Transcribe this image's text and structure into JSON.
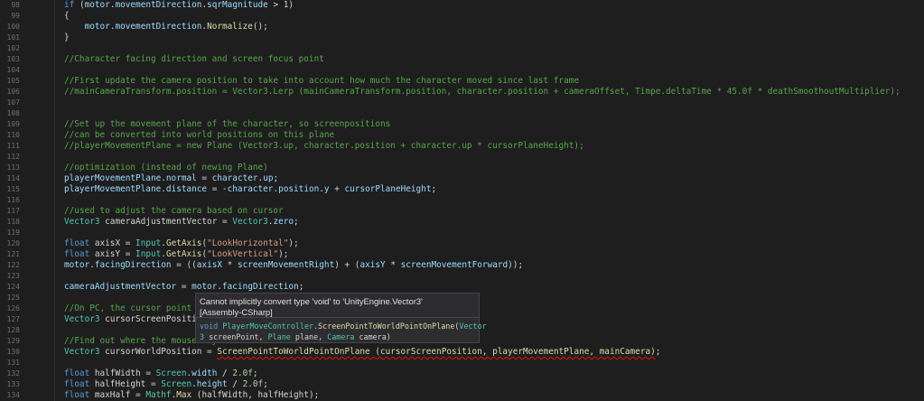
{
  "colors": {
    "background": "#1e1e1e",
    "comment": "#57a64a",
    "keyword": "#569cd6",
    "string": "#d69d85",
    "type": "#4ec9b0",
    "method": "#dcdcaa",
    "field": "#9cdcfe",
    "error_squiggle": "#e51400"
  },
  "lines": [
    {
      "num": "98",
      "tokens": [
        [
          "k",
          "if"
        ],
        [
          "p",
          " ("
        ],
        [
          "f",
          "motor"
        ],
        [
          "p",
          "."
        ],
        [
          "f",
          "movementDirection"
        ],
        [
          "p",
          "."
        ],
        [
          "f",
          "sqrMagnitude"
        ],
        [
          "p",
          " > 1)"
        ]
      ]
    },
    {
      "num": "99",
      "tokens": [
        [
          "p",
          "{"
        ]
      ]
    },
    {
      "num": "100",
      "tokens": [
        [
          "p",
          "    "
        ],
        [
          "f",
          "motor"
        ],
        [
          "p",
          "."
        ],
        [
          "f",
          "movementDirection"
        ],
        [
          "p",
          "."
        ],
        [
          "m",
          "Normalize"
        ],
        [
          "p",
          "();"
        ]
      ]
    },
    {
      "num": "101",
      "tokens": [
        [
          "p",
          "}"
        ]
      ]
    },
    {
      "num": "102",
      "tokens": []
    },
    {
      "num": "103",
      "tokens": [
        [
          "c",
          "//Character facing direction and screen focus point"
        ]
      ]
    },
    {
      "num": "104",
      "tokens": []
    },
    {
      "num": "105",
      "tokens": [
        [
          "c",
          "//First update the camera position to take into account how much the character moved since last frame"
        ]
      ]
    },
    {
      "num": "106",
      "tokens": [
        [
          "c",
          "//mainCameraTransform.position = Vector3.Lerp (mainCameraTransform.position, character.position + cameraOffset, Timpe.deltaTime * 45.0f * deathSmoothoutMultiplier);"
        ]
      ]
    },
    {
      "num": "107",
      "tokens": []
    },
    {
      "num": "108",
      "tokens": []
    },
    {
      "num": "109",
      "tokens": [
        [
          "c",
          "//Set up the movement plane of the character, so screenpositions"
        ]
      ]
    },
    {
      "num": "110",
      "tokens": [
        [
          "c",
          "//can be converted into world positions on this plane"
        ]
      ]
    },
    {
      "num": "111",
      "tokens": [
        [
          "c",
          "//playerMovementPlane = new Plane (Vector3.up, character.position + character.up * cursorPlaneHeight);"
        ]
      ]
    },
    {
      "num": "112",
      "tokens": []
    },
    {
      "num": "113",
      "tokens": [
        [
          "c",
          "//optimization (instead of newing Plane)"
        ]
      ]
    },
    {
      "num": "114",
      "tokens": [
        [
          "f",
          "playerMovementPlane"
        ],
        [
          "p",
          "."
        ],
        [
          "f",
          "normal"
        ],
        [
          "p",
          " = "
        ],
        [
          "f",
          "character"
        ],
        [
          "p",
          "."
        ],
        [
          "f",
          "up"
        ],
        [
          "p",
          ";"
        ]
      ]
    },
    {
      "num": "115",
      "tokens": [
        [
          "f",
          "playerMovementPlane"
        ],
        [
          "p",
          "."
        ],
        [
          "f",
          "distance"
        ],
        [
          "p",
          " = -"
        ],
        [
          "f",
          "character"
        ],
        [
          "p",
          "."
        ],
        [
          "f",
          "position"
        ],
        [
          "p",
          "."
        ],
        [
          "f",
          "y"
        ],
        [
          "p",
          " + "
        ],
        [
          "f",
          "cursorPlaneHeight"
        ],
        [
          "p",
          ";"
        ]
      ]
    },
    {
      "num": "116",
      "tokens": []
    },
    {
      "num": "117",
      "tokens": [
        [
          "c",
          "//used to adjust the camera based on cursor"
        ]
      ]
    },
    {
      "num": "118",
      "tokens": [
        [
          "t",
          "Vector3"
        ],
        [
          "p",
          " cameraAdjustmentVector = "
        ],
        [
          "t",
          "Vector3"
        ],
        [
          "p",
          "."
        ],
        [
          "f",
          "zero"
        ],
        [
          "p",
          ";"
        ]
      ]
    },
    {
      "num": "119",
      "tokens": []
    },
    {
      "num": "120",
      "tokens": [
        [
          "k",
          "float"
        ],
        [
          "p",
          " axisX = "
        ],
        [
          "t",
          "Input"
        ],
        [
          "p",
          "."
        ],
        [
          "m",
          "GetAxis"
        ],
        [
          "p",
          "("
        ],
        [
          "s",
          "\"LookHorizontal\""
        ],
        [
          "p",
          ");"
        ]
      ]
    },
    {
      "num": "121",
      "tokens": [
        [
          "k",
          "float"
        ],
        [
          "p",
          " axisY = "
        ],
        [
          "t",
          "Input"
        ],
        [
          "p",
          "."
        ],
        [
          "m",
          "GetAxis"
        ],
        [
          "p",
          "("
        ],
        [
          "s",
          "\"LookVertical\""
        ],
        [
          "p",
          ");"
        ]
      ]
    },
    {
      "num": "122",
      "tokens": [
        [
          "f",
          "motor"
        ],
        [
          "p",
          "."
        ],
        [
          "f",
          "facingDirection"
        ],
        [
          "p",
          " = (("
        ],
        [
          "f",
          "axisX"
        ],
        [
          "p",
          " * "
        ],
        [
          "f",
          "screenMovementRight"
        ],
        [
          "p",
          ") + ("
        ],
        [
          "f",
          "axisY"
        ],
        [
          "p",
          " * "
        ],
        [
          "f",
          "screenMovementForward"
        ],
        [
          "p",
          "));"
        ]
      ]
    },
    {
      "num": "123",
      "tokens": []
    },
    {
      "num": "124",
      "tokens": [
        [
          "f",
          "cameraAdjustmentVector"
        ],
        [
          "p",
          " = "
        ],
        [
          "f",
          "motor"
        ],
        [
          "p",
          "."
        ],
        [
          "f",
          "facingDirection"
        ],
        [
          "p",
          ";"
        ]
      ]
    },
    {
      "num": "125",
      "tokens": []
    },
    {
      "num": "126",
      "tokens": [
        [
          "c",
          "//On PC, the cursor point is t"
        ]
      ]
    },
    {
      "num": "127",
      "tokens": [
        [
          "t",
          "Vector3"
        ],
        [
          "p",
          " cursorScreenPosition = "
        ]
      ]
    },
    {
      "num": "128",
      "tokens": []
    },
    {
      "num": "129",
      "tokens": [
        [
          "c",
          "//Find out where the mouse ray"
        ]
      ]
    },
    {
      "num": "130",
      "tokens": [
        [
          "t",
          "Vector3"
        ],
        [
          "p",
          " cursorWorldPosition = "
        ],
        [
          "e",
          "ScreenPointToWorldPointOnPlane (cursorScreenPosition, playerMovementPlane, mainCamera)"
        ],
        [
          "p",
          ";"
        ]
      ]
    },
    {
      "num": "131",
      "tokens": []
    },
    {
      "num": "132",
      "tokens": [
        [
          "k",
          "float"
        ],
        [
          "p",
          " halfWidth = "
        ],
        [
          "t",
          "Screen"
        ],
        [
          "p",
          "."
        ],
        [
          "f",
          "width"
        ],
        [
          "p",
          " / "
        ],
        [
          "n",
          "2.0f"
        ],
        [
          "p",
          ";"
        ]
      ]
    },
    {
      "num": "133",
      "tokens": [
        [
          "k",
          "float"
        ],
        [
          "p",
          " halfHeight = "
        ],
        [
          "t",
          "Screen"
        ],
        [
          "p",
          "."
        ],
        [
          "f",
          "height"
        ],
        [
          "p",
          " / "
        ],
        [
          "n",
          "2.0f"
        ],
        [
          "p",
          ";"
        ]
      ]
    },
    {
      "num": "134",
      "tokens": [
        [
          "k",
          "float"
        ],
        [
          "p",
          " maxHalf = "
        ],
        [
          "t",
          "Mathf"
        ],
        [
          "p",
          "."
        ],
        [
          "m",
          "Max"
        ],
        [
          "p",
          " (halfWidth, halfHeight);"
        ]
      ]
    }
  ],
  "tooltip": {
    "error_message": "Cannot implicitly convert type 'void' to 'UnityEngine.Vector3'",
    "assembly": "[Assembly-CSharp]",
    "signature_line1": [
      [
        "k",
        "void "
      ],
      [
        "t",
        "PlayerMoveController"
      ],
      [
        "p",
        "."
      ],
      [
        "m",
        "ScreenPointToWorldPointOnPlane"
      ],
      [
        "p",
        "("
      ],
      [
        "t",
        "Vector"
      ]
    ],
    "signature_line2": [
      [
        "t",
        "3"
      ],
      [
        "p",
        " screenPoint, "
      ],
      [
        "t",
        "Plane"
      ],
      [
        "p",
        " plane, "
      ],
      [
        "t",
        "Camera"
      ],
      [
        "p",
        " camera)"
      ]
    ]
  }
}
